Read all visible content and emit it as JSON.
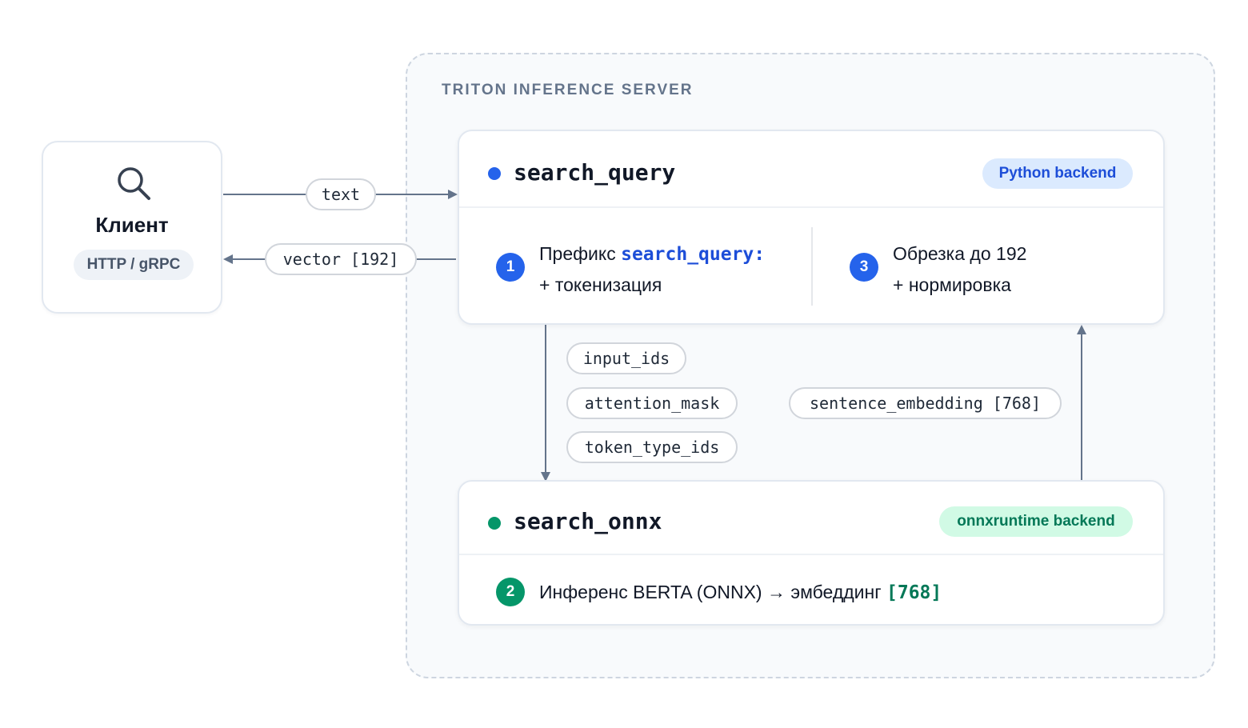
{
  "server": {
    "label": "TRITON INFERENCE SERVER"
  },
  "client": {
    "title": "Клиент",
    "protocol": "HTTP / gRPC",
    "icon": "search-icon"
  },
  "arrows": {
    "request_label": "text",
    "response_label": "vector [192]"
  },
  "search_query": {
    "name": "search_query",
    "backend": "Python backend",
    "step1": {
      "num": "1",
      "text_a": "Префикс ",
      "code": "search_query:",
      "text_b": "+ токенизация"
    },
    "step3": {
      "num": "3",
      "text_a": "Обрезка до 192",
      "text_b": "+ нормировка"
    }
  },
  "tensors_down": [
    "input_ids",
    "attention_mask",
    "token_type_ids"
  ],
  "tensor_up": "sentence_embedding [768]",
  "search_onnx": {
    "name": "search_onnx",
    "backend": "onnxruntime backend",
    "step2": {
      "num": "2",
      "text": "Инференс BERTA (ONNX) → эмбеддинг ",
      "code": "[768]"
    }
  },
  "colors": {
    "python_accent": "#2563eb",
    "onnx_accent": "#059669",
    "connector": "#64748b",
    "border": "#e2e8f0"
  }
}
